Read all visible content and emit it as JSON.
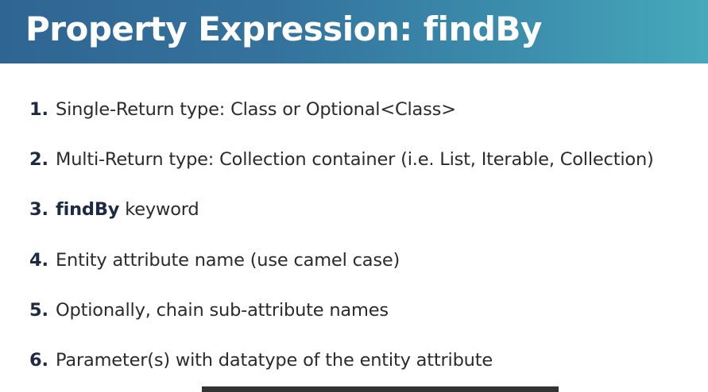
{
  "slide": {
    "title": "Property Expression: findBy",
    "items": [
      {
        "number": "1.",
        "bold": "",
        "text": "Single-Return type:  Class or Optional<Class>"
      },
      {
        "number": "2.",
        "bold": "",
        "text": "Multi-Return type: Collection container (i.e. List, Iterable, Collection)"
      },
      {
        "number": "3.",
        "bold": "findBy",
        "text": " keyword"
      },
      {
        "number": "4.",
        "bold": "",
        "text": "Entity attribute name (use camel case)"
      },
      {
        "number": "5.",
        "bold": "",
        "text": "Optionally, chain sub-attribute names"
      },
      {
        "number": "6.",
        "bold": "",
        "text": "Parameter(s) with datatype of the entity attribute"
      }
    ]
  },
  "colors": {
    "header_start": "#2f6592",
    "header_end": "#46a9bb",
    "title_text": "#ffffff",
    "number_text": "#1e2a44",
    "body_text": "#2b2b2b",
    "bottom_bar": "#333333"
  }
}
